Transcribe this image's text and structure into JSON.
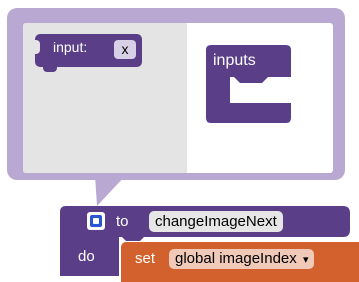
{
  "mutator": {
    "flyout_block": {
      "label": "input:",
      "field": "x"
    },
    "container_block": {
      "label": "inputs"
    }
  },
  "procedure": {
    "to_label": "to",
    "name": "changeImageNext",
    "do_label": "do",
    "statement": {
      "keyword": "set",
      "variable": "global imageIndex",
      "dropdown_icon": "chevron-down-icon"
    }
  },
  "colors": {
    "procedure_block": "#5a3f88",
    "set_block": "#d3612d",
    "bubble_border": "#b9a9d2",
    "mutator_button": "#2a56d6"
  }
}
